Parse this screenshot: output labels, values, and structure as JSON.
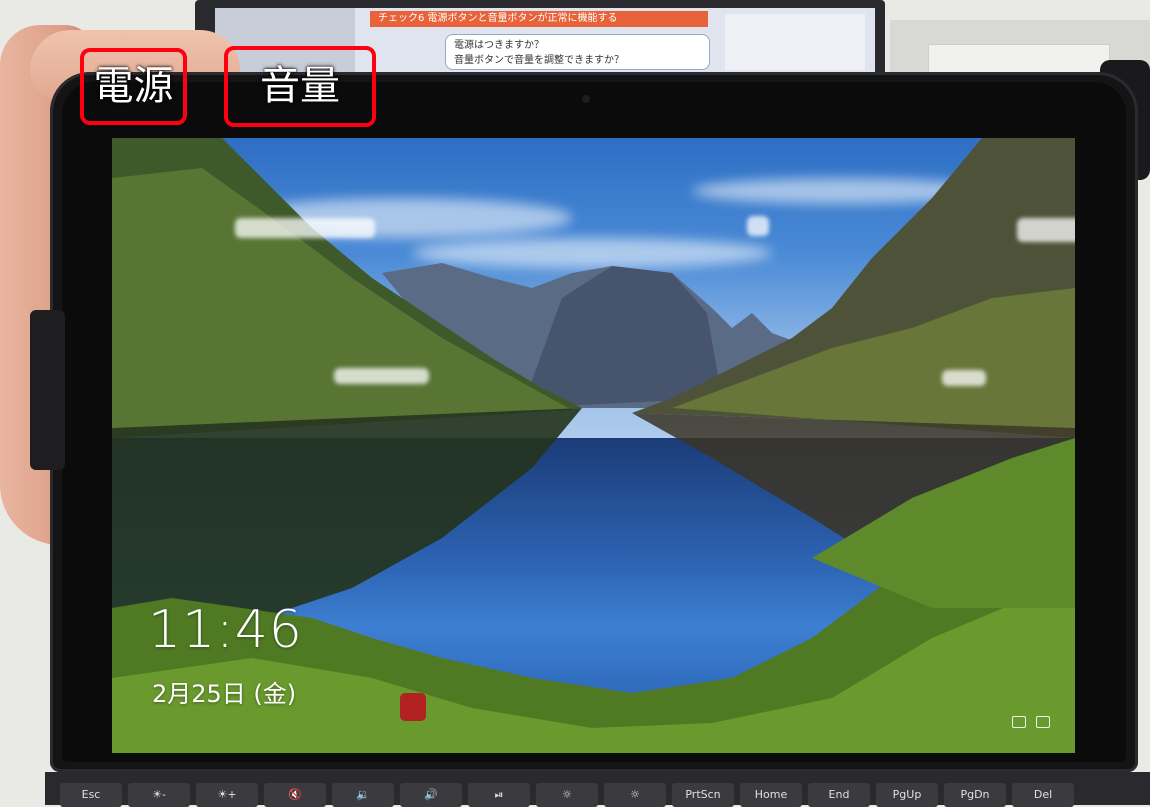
{
  "annotations": {
    "power_label": "電源",
    "volume_label": "音量",
    "box_color": "#ff0010"
  },
  "background_screen": {
    "banner_text": "チェック6 電源ボタンと音量ボタンが正常に機能する",
    "bubble_line1": "電源はつきますか？",
    "bubble_line2": "音量ボタンで音量を調整できますか？"
  },
  "lock_screen": {
    "time": "11:46",
    "date": "2月25日 (金)"
  },
  "keyboard": {
    "keys": [
      "Esc",
      "☀-",
      "☀+",
      "🔇",
      "🔉",
      "🔊",
      "⏯",
      "☼",
      "☼",
      "PrtScn",
      "Home",
      "End",
      "PgUp",
      "PgDn",
      "Del"
    ]
  }
}
